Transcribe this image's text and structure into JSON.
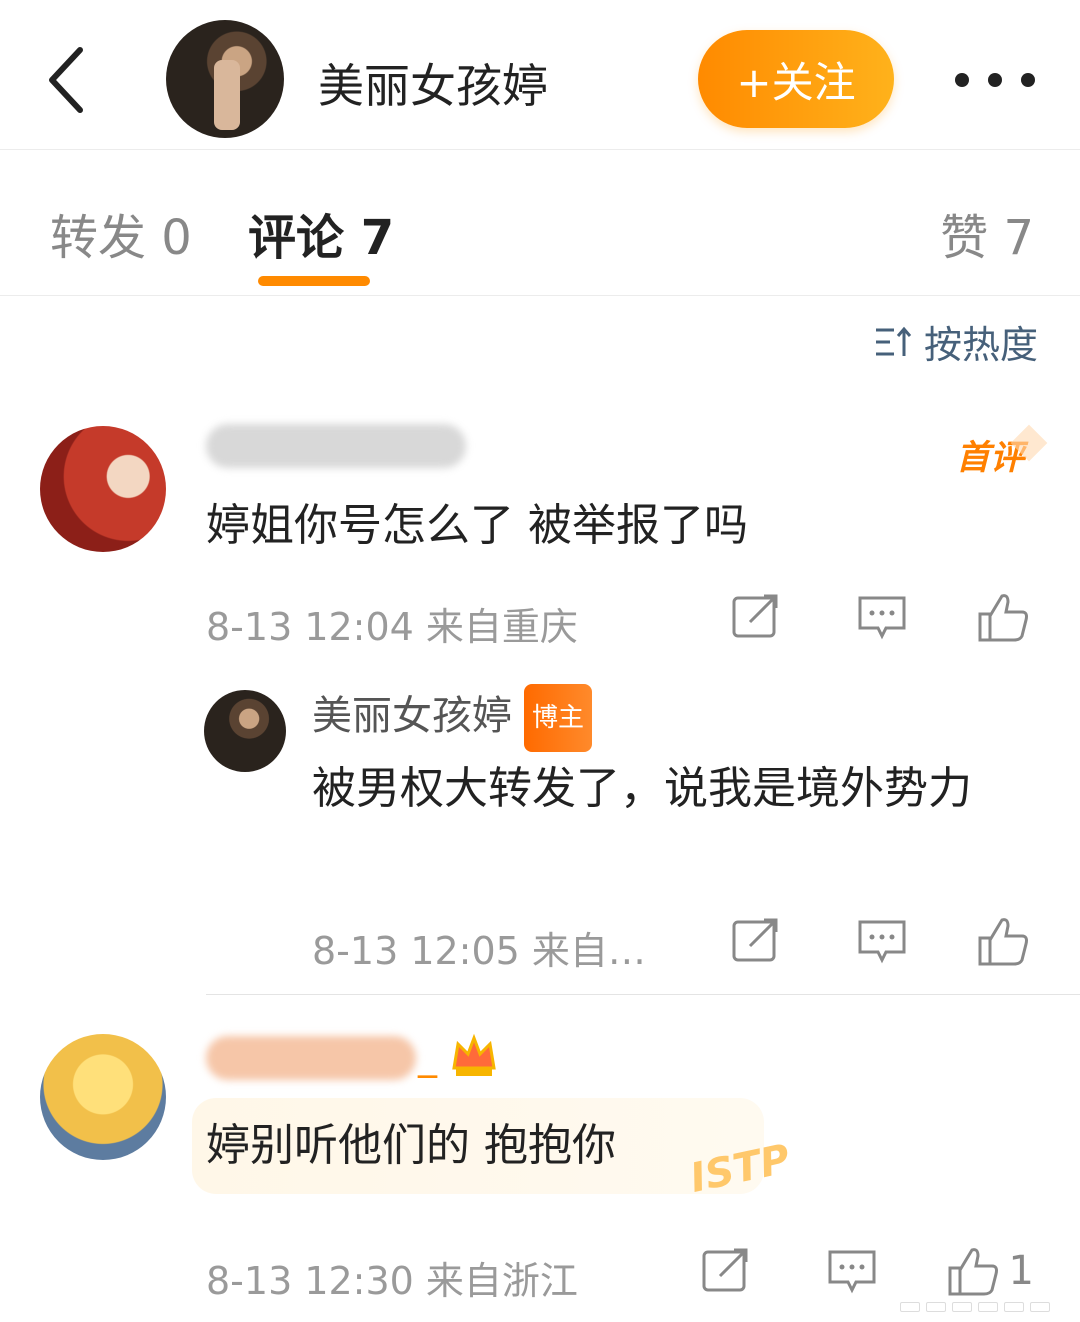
{
  "header": {
    "author_name": "美丽女孩婷",
    "follow_label": "+关注"
  },
  "tabs": {
    "repost": "转发 0",
    "comment": "评论 7",
    "like": "赞 7"
  },
  "sort_label": "按热度",
  "comments": [
    {
      "first_badge": "首评",
      "text": "婷姐你号怎么了 被举报了吗",
      "meta": "8-13 12:04  来自重庆"
    },
    {
      "name": "美丽女孩婷",
      "badge": "博主",
      "text": "被男权大转发了，说我是境外势力",
      "meta": "8-13 12:05  来自…"
    },
    {
      "name_suffix": "_",
      "text": "婷别听他们的 抱抱你",
      "decoration": "ISTP",
      "meta": "8-13 12:30  来自浙江",
      "like_count": "1"
    }
  ]
}
